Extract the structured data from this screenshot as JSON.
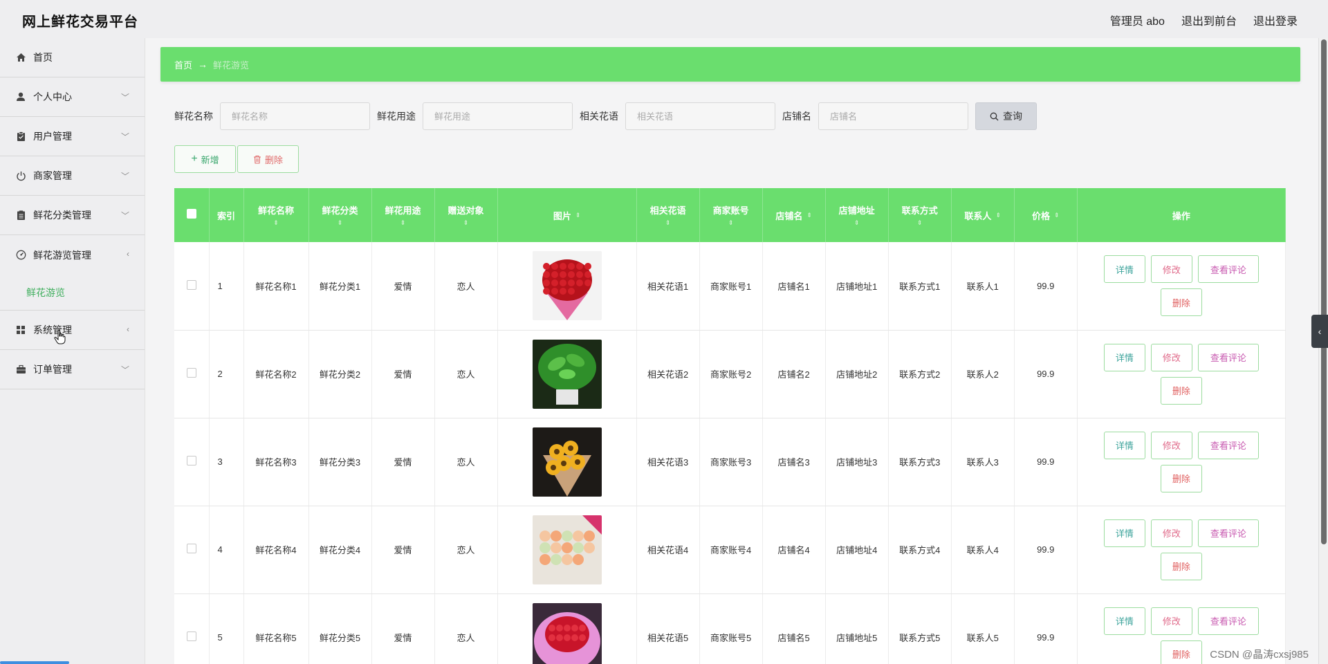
{
  "app": {
    "title": "网上鲜花交易平台"
  },
  "header": {
    "admin": "管理员 abo",
    "to_front": "退出到前台",
    "logout": "退出登录"
  },
  "sidebar": {
    "items": [
      {
        "label": "首页",
        "icon": "home-icon",
        "has_chevron": false
      },
      {
        "label": "个人中心",
        "icon": "user-icon",
        "has_chevron": true
      },
      {
        "label": "用户管理",
        "icon": "clipboard-icon",
        "has_chevron": true
      },
      {
        "label": "商家管理",
        "icon": "power-icon",
        "has_chevron": true
      },
      {
        "label": "鲜花分类管理",
        "icon": "document-icon",
        "has_chevron": true
      },
      {
        "label": "鲜花游览管理",
        "icon": "dashboard-icon",
        "has_chevron": true,
        "sub": "鲜花游览"
      },
      {
        "label": "系统管理",
        "icon": "grid-icon",
        "has_chevron": true
      },
      {
        "label": "订单管理",
        "icon": "briefcase-icon",
        "has_chevron": true
      }
    ]
  },
  "breadcrumb": {
    "home": "首页",
    "separator": "→",
    "current": "鲜花游览"
  },
  "search": {
    "fields": [
      {
        "label": "鲜花名称",
        "placeholder": "鲜花名称"
      },
      {
        "label": "鲜花用途",
        "placeholder": "鲜花用途"
      },
      {
        "label": "相关花语",
        "placeholder": "相关花语"
      },
      {
        "label": "店铺名",
        "placeholder": "店铺名"
      }
    ],
    "query_label": "查询"
  },
  "actions": {
    "add_label": "新增",
    "delete_label": "删除"
  },
  "table": {
    "headers": [
      "索引",
      "鲜花名称",
      "鲜花分类",
      "鲜花用途",
      "赠送对象",
      "图片",
      "相关花语",
      "商家账号",
      "店铺名",
      "店铺地址",
      "联系方式",
      "联系人",
      "价格",
      "操作"
    ],
    "rows": [
      {
        "index": "1",
        "name": "鲜花名称1",
        "category": "鲜花分类1",
        "usage": "爱情",
        "target": "恋人",
        "image": "red-roses",
        "words": "相关花语1",
        "account": "商家账号1",
        "shop": "店铺名1",
        "address": "店铺地址1",
        "contact": "联系方式1",
        "person": "联系人1",
        "price": "99.9"
      },
      {
        "index": "2",
        "name": "鲜花名称2",
        "category": "鲜花分类2",
        "usage": "爱情",
        "target": "恋人",
        "image": "green-plant",
        "words": "相关花语2",
        "account": "商家账号2",
        "shop": "店铺名2",
        "address": "店铺地址2",
        "contact": "联系方式2",
        "person": "联系人2",
        "price": "99.9"
      },
      {
        "index": "3",
        "name": "鲜花名称3",
        "category": "鲜花分类3",
        "usage": "爱情",
        "target": "恋人",
        "image": "sunflowers",
        "words": "相关花语3",
        "account": "商家账号3",
        "shop": "店铺名3",
        "address": "店铺地址3",
        "contact": "联系方式3",
        "person": "联系人3",
        "price": "99.9"
      },
      {
        "index": "4",
        "name": "鲜花名称4",
        "category": "鲜花分类4",
        "usage": "爱情",
        "target": "恋人",
        "image": "peach-roses",
        "words": "相关花语4",
        "account": "商家账号4",
        "shop": "店铺名4",
        "address": "店铺地址4",
        "contact": "联系方式4",
        "person": "联系人4",
        "price": "99.9"
      },
      {
        "index": "5",
        "name": "鲜花名称5",
        "category": "鲜花分类5",
        "usage": "爱情",
        "target": "恋人",
        "image": "pink-bouquet",
        "words": "相关花语5",
        "account": "商家账号5",
        "shop": "店铺名5",
        "address": "店铺地址5",
        "contact": "联系方式5",
        "person": "联系人5",
        "price": "99.9"
      }
    ],
    "row_actions": {
      "detail": "详情",
      "edit": "修改",
      "review": "查看评论",
      "delete": "删除"
    }
  },
  "watermark": "CSDN @晶涛cxsj985",
  "colors": {
    "accent": "#6ade6e",
    "sub_active": "#3fae5d"
  }
}
